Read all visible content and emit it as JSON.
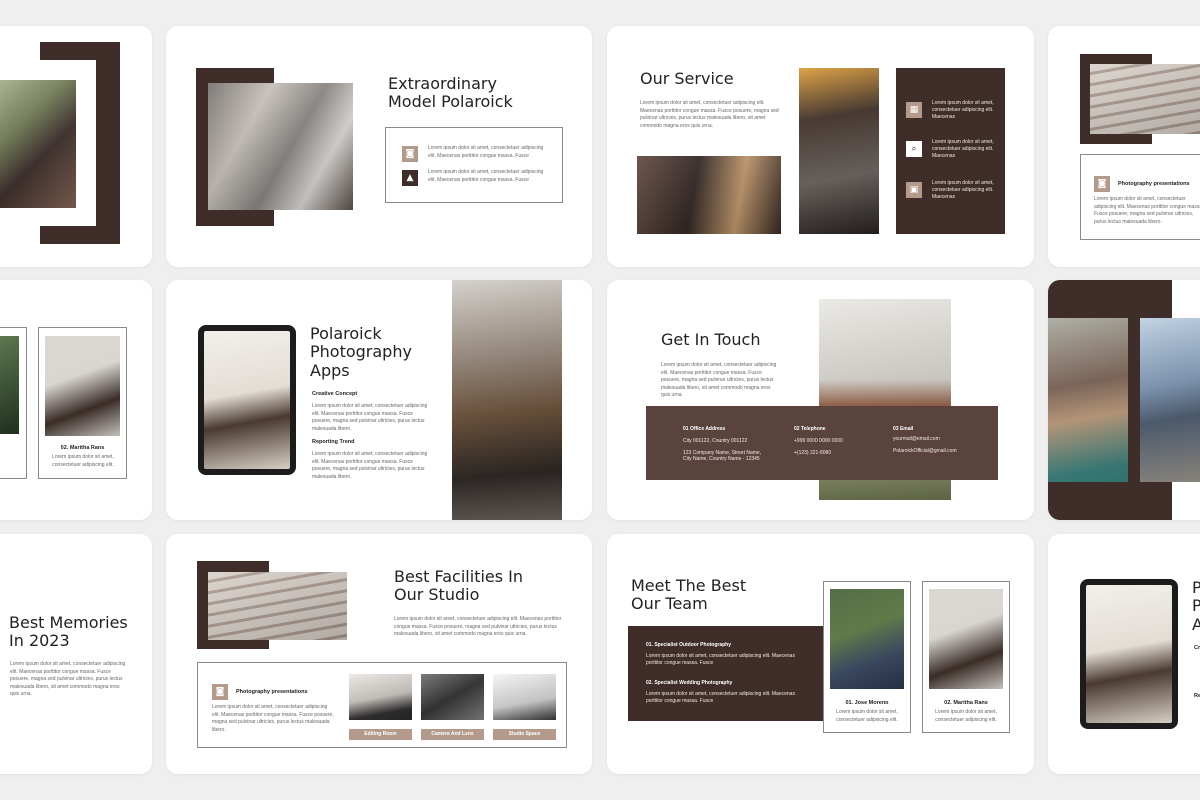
{
  "colors": {
    "dark": "#3f2d29",
    "tan": "#b49a8b",
    "background": "#efefef",
    "card": "#ffffff"
  },
  "lorem": "Lorem ipsum dolor sit amet, consectetuer adipiscing elit. Maecenas porttitor congue massa. Fusce posuere, magna sed pulvinar ultricies, purus lectus malesuada libero, sit amet commodo magna eros quis urna.",
  "lorem_short": "Lorem ipsum dolor sit amet, consectetuer adipiscing elit. Maecenas porttitor congue massa. Fusce",
  "lorem_mid": "Lorem ipsum dolor sit amet, consectetuer adipiscing elit. Maecenas porttitor congue massa. Fusce posuere, magna sed pulvinar ultricies, purus lectus malesuada libero.",
  "slide_model": {
    "title_line1": "Extraordinary",
    "title_line2": "Model Polaroick",
    "item1": "Lorem ipsum dolor sit amet, consectetuer adipiscing elit. Maecenas porttitor congue massa. Fusce",
    "item2": "Lorem ipsum dolor sit amet, consectetuer adipiscing elit. Maecenas porttitor congue massa. Fusce"
  },
  "slide_service": {
    "title": "Our Service",
    "body": "Lorem ipsum dolor sit amet, consectetuer adipiscing elit. Maecenas porttitor congue massa. Fusce posuere, magna sed pulvinar ultricies, purus lectus malesuada libero, sit amet commodo magna eros quis urna.",
    "side_item": "Lorem ipsum dolor sit amet, consectetuer adipiscing elit. Maecenas"
  },
  "slide_presentation_right": {
    "heading": "Photography presentations"
  },
  "slide_team_left": {
    "member_name": "02. Maritha Rans",
    "member_text": "Lorem ipsum dolor sit amet, consectetuer adipiscing elit."
  },
  "slide_apps": {
    "title_line1": "Polaroick",
    "title_line2": "Photography",
    "title_line3": "Apps",
    "concept_label": "Creative Concept",
    "trend_label": "Reporting Trend"
  },
  "slide_contact": {
    "title": "Get In Touch",
    "col1_label": "01  Office Address",
    "col1_line1": "City 001122, Country 001122",
    "col1_line2": "123 Company Name, Street Name,",
    "col1_line3": "City Name, Country Name - 12345",
    "col2_label": "02  Telephone",
    "col2_line1": "+999 0000 0000 0000",
    "col2_line2": "+(123) 321-8080",
    "col3_label": "03  Email",
    "col3_line1": "yourmail@email.com",
    "col3_line2": "PolaroickOfficial@gmail.com"
  },
  "slide_memories": {
    "title_line1": "Best Memories",
    "title_line2": "In 2023"
  },
  "slide_facilities": {
    "title_line1": "Best Facilities In",
    "title_line2": "Our Studio",
    "box_heading": "Photography presentations",
    "labels": [
      "Editing Room",
      "Camera And Lens",
      "Studio Space"
    ]
  },
  "slide_team": {
    "title_line1": "Meet The Best",
    "title_line2": "Our Team",
    "item1": "01. Specialist Outdoor Photography",
    "item2": "02. Specialist Wedding Photography",
    "member1": "01. Jose Moreno",
    "member2": "02. Maritha Rans",
    "member_text": "Lorem ipsum dolor sit amet, consectetuer adipiscing elit."
  },
  "slide_apps_right": {
    "title_letters": "P\nP\nA",
    "lbl_c": "Cr",
    "lbl_r": "Re"
  },
  "icons": [
    "camera-icon",
    "mountain-icon",
    "calendar-icon",
    "search-icon",
    "image-icon"
  ]
}
